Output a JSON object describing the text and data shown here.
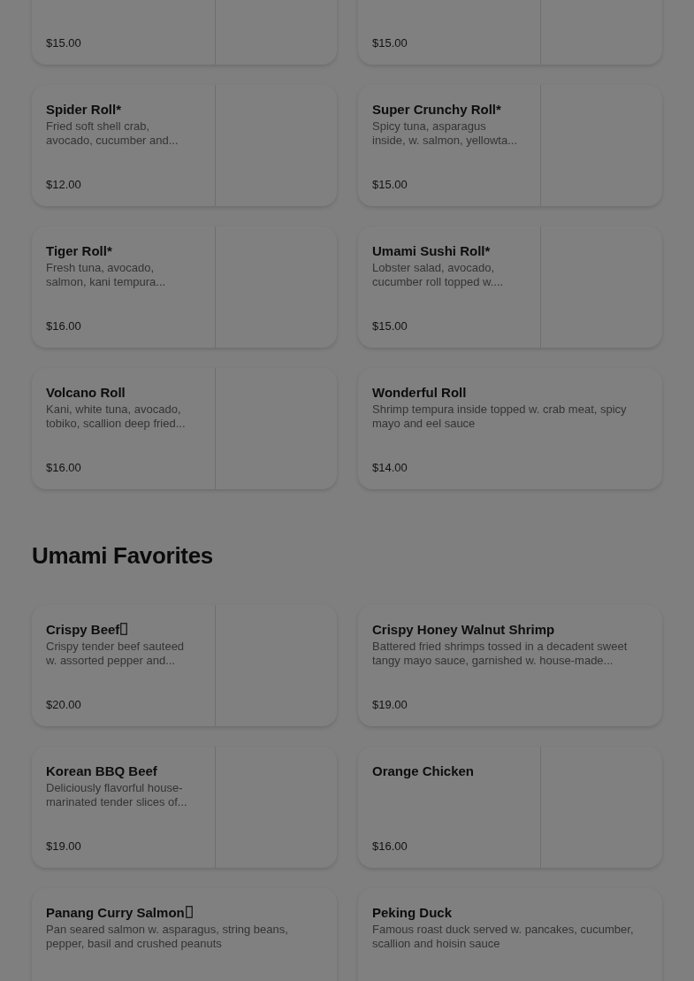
{
  "sections": [
    {
      "items": [
        {
          "price": "$15.00",
          "has_image": true
        },
        {
          "price": "$15.00",
          "has_image": true
        },
        {
          "name": "Spider Roll*",
          "description": "Fried soft shell crab,\navocado, cucumber and...",
          "price": "$12.00",
          "has_image": true
        },
        {
          "name": "Super Crunchy Roll*",
          "description": "Spicy tuna, asparagus\ninside, w. salmon, yellowta...",
          "price": "$15.00",
          "has_image": true
        },
        {
          "name": "Tiger Roll*",
          "description": "Fresh tuna, avocado,\nsalmon, kani tempura...",
          "price": "$16.00",
          "has_image": true
        },
        {
          "name": "Umami Sushi Roll*",
          "description": "Lobster salad, avocado,\ncucumber roll topped w....",
          "price": "$15.00",
          "has_image": true
        },
        {
          "name": "Volcano Roll",
          "description": "Kani, white tuna, avocado,\ntobiko, scallion deep fried...",
          "price": "$16.00",
          "has_image": true
        },
        {
          "name": "Wonderful Roll",
          "description": "Shrimp tempura inside topped w. crab meat, spicy\nmayo and eel sauce",
          "price": "$14.00",
          "has_image": false
        }
      ]
    },
    {
      "heading": "Umami Favorites",
      "items": [
        {
          "name": "Crispy Beef",
          "missing_glyph": true,
          "description": "Crispy tender beef sauteed\nw. assorted pepper and...",
          "price": "$20.00",
          "has_image": true
        },
        {
          "name": "Crispy Honey Walnut Shrimp",
          "description": "Battered fried shrimps tossed in a decadent sweet\ntangy mayo sauce, garnished w. house-made...",
          "price": "$19.00",
          "has_image": false
        },
        {
          "name": "Korean BBQ Beef",
          "description": "Deliciously flavorful house-\nmarinated tender slices of...",
          "price": "$19.00",
          "has_image": true
        },
        {
          "name": "Orange Chicken",
          "price": "$16.00",
          "has_image": true
        },
        {
          "name": "Panang Curry Salmon",
          "missing_glyph": true,
          "description": "Pan seared salmon w. asparagus, string beans,\npepper, basil and crushed peanuts",
          "has_image": false
        },
        {
          "name": "Peking Duck",
          "description": "Famous roast duck served w. pancakes, cucumber,\nscallion and hoisin sauce",
          "has_image": false
        }
      ]
    }
  ]
}
